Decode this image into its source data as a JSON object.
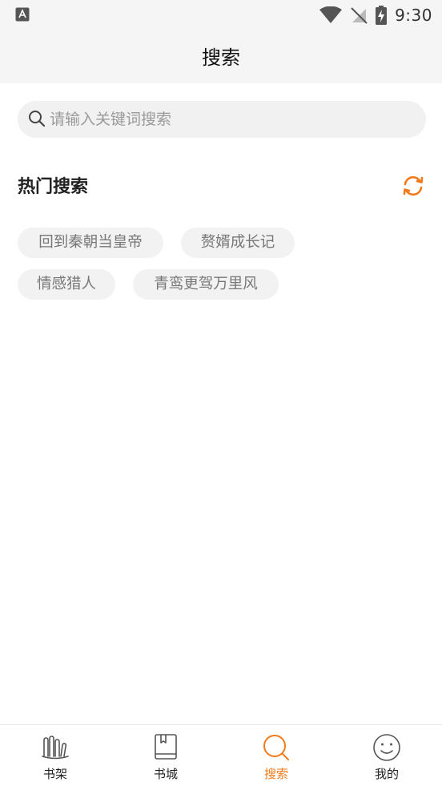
{
  "status_bar": {
    "time": "9:30"
  },
  "header": {
    "title": "搜索"
  },
  "search": {
    "placeholder": "请输入关键词搜索",
    "value": ""
  },
  "hot_search": {
    "title": "热门搜索",
    "tags": [
      "回到秦朝当皇帝",
      "赘婿成长记",
      "情感猎人",
      "青鸾更驾万里风"
    ]
  },
  "tabbar": {
    "tabs": [
      {
        "label": "书架",
        "icon": "bookshelf-icon"
      },
      {
        "label": "书城",
        "icon": "bookstore-icon"
      },
      {
        "label": "搜索",
        "icon": "search-icon"
      },
      {
        "label": "我的",
        "icon": "profile-icon"
      }
    ],
    "active": 2
  },
  "colors": {
    "accent": "#f27a1a",
    "tag_bg": "#f2f2f2",
    "header_bg": "#f5f5f5"
  }
}
